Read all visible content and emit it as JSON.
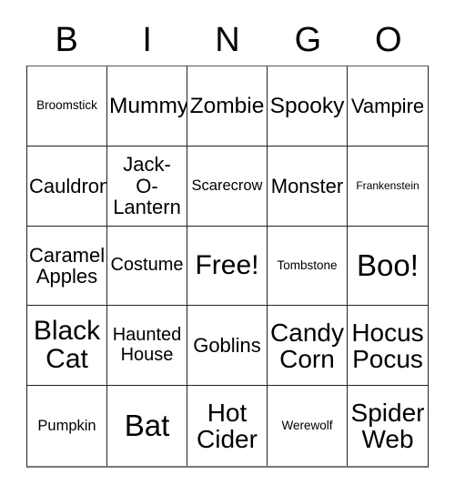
{
  "card": {
    "title_letters": [
      "B",
      "I",
      "N",
      "G",
      "O"
    ],
    "columns": 5,
    "rows": 5,
    "free_space_label": "Free!",
    "free_space_position": "N3",
    "border_color": "#222222",
    "background_color": "#ffffff",
    "text_color": "#000000",
    "cells": [
      {
        "text": "Broomstick",
        "size": "s-sm"
      },
      {
        "text": "Mummy",
        "size": "s-2xl"
      },
      {
        "text": "Zombie",
        "size": "s-2xl"
      },
      {
        "text": "Spooky",
        "size": "s-2xl"
      },
      {
        "text": "Vampire",
        "size": "s-xl"
      },
      {
        "text": "Cauldron",
        "size": "s-xl"
      },
      {
        "text": "Jack-\nO-\nLantern",
        "size": "s-xl"
      },
      {
        "text": "Scarecrow",
        "size": "s-md"
      },
      {
        "text": "Monster",
        "size": "s-xl"
      },
      {
        "text": "Frankenstein",
        "size": "s-xs"
      },
      {
        "text": "Caramel\nApples",
        "size": "s-xl"
      },
      {
        "text": "Costume",
        "size": "s-lg"
      },
      {
        "text": "Free!",
        "size": "s-4xl"
      },
      {
        "text": "Tombstone",
        "size": "s-sm"
      },
      {
        "text": "Boo!",
        "size": "s-5xl"
      },
      {
        "text": "Black\nCat",
        "size": "s-4xl"
      },
      {
        "text": "Haunted\nHouse",
        "size": "s-lg"
      },
      {
        "text": "Goblins",
        "size": "s-xl"
      },
      {
        "text": "Candy\nCorn",
        "size": "s-3xl"
      },
      {
        "text": "Hocus\nPocus",
        "size": "s-3xl"
      },
      {
        "text": "Pumpkin",
        "size": "s-md"
      },
      {
        "text": "Bat",
        "size": "s-5xl"
      },
      {
        "text": "Hot\nCider",
        "size": "s-3xl"
      },
      {
        "text": "Werewolf",
        "size": "s-sm"
      },
      {
        "text": "Spider\nWeb",
        "size": "s-3xl"
      }
    ]
  }
}
